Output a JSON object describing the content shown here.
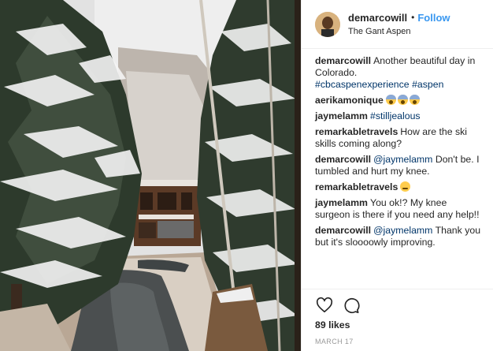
{
  "post": {
    "author": "demarcowill",
    "location": "The Gant Aspen",
    "follow_label": "Follow",
    "separator": "•",
    "image_description": "photo-snowy-pool-courtyard"
  },
  "comments": [
    {
      "user": "demarcowill",
      "parts": [
        {
          "type": "text",
          "value": "Another beautiful day in Colorado."
        },
        {
          "type": "linebreak"
        },
        {
          "type": "hashtag",
          "value": "#cbcaspenexperience"
        },
        {
          "type": "text",
          "value": " "
        },
        {
          "type": "hashtag",
          "value": "#aspen"
        }
      ]
    },
    {
      "user": "aerikamonique",
      "parts": [
        {
          "type": "emoji",
          "value": "scream-icon"
        },
        {
          "type": "emoji",
          "value": "scream-icon"
        },
        {
          "type": "emoji",
          "value": "scream-icon"
        }
      ]
    },
    {
      "user": "jaymelamm",
      "parts": [
        {
          "type": "hashtag",
          "value": "#stilljealous"
        }
      ]
    },
    {
      "user": "remarkabletravels",
      "parts": [
        {
          "type": "text",
          "value": "How are the ski skills coming along?"
        }
      ]
    },
    {
      "user": "demarcowill",
      "parts": [
        {
          "type": "mention",
          "value": "@jaymelamm"
        },
        {
          "type": "text",
          "value": " Don't be. I tumbled and hurt my knee."
        }
      ]
    },
    {
      "user": "remarkabletravels",
      "parts": [
        {
          "type": "emoji",
          "value": "relieved-icon"
        }
      ]
    },
    {
      "user": "jaymelamm",
      "parts": [
        {
          "type": "text",
          "value": "You ok!? My knee surgeon is there if you need any help!!"
        }
      ]
    },
    {
      "user": "demarcowill",
      "parts": [
        {
          "type": "mention",
          "value": "@jaymelamm"
        },
        {
          "type": "text",
          "value": " Thank you but it's sloooowly improving."
        }
      ]
    }
  ],
  "actions": {
    "like_icon": "heart-icon",
    "comment_icon": "comment-icon",
    "likes_text": "89 likes",
    "date_text": "MARCH 17"
  },
  "colors": {
    "link": "#003569",
    "follow": "#3897f0",
    "text": "#262626",
    "muted": "#999999"
  }
}
